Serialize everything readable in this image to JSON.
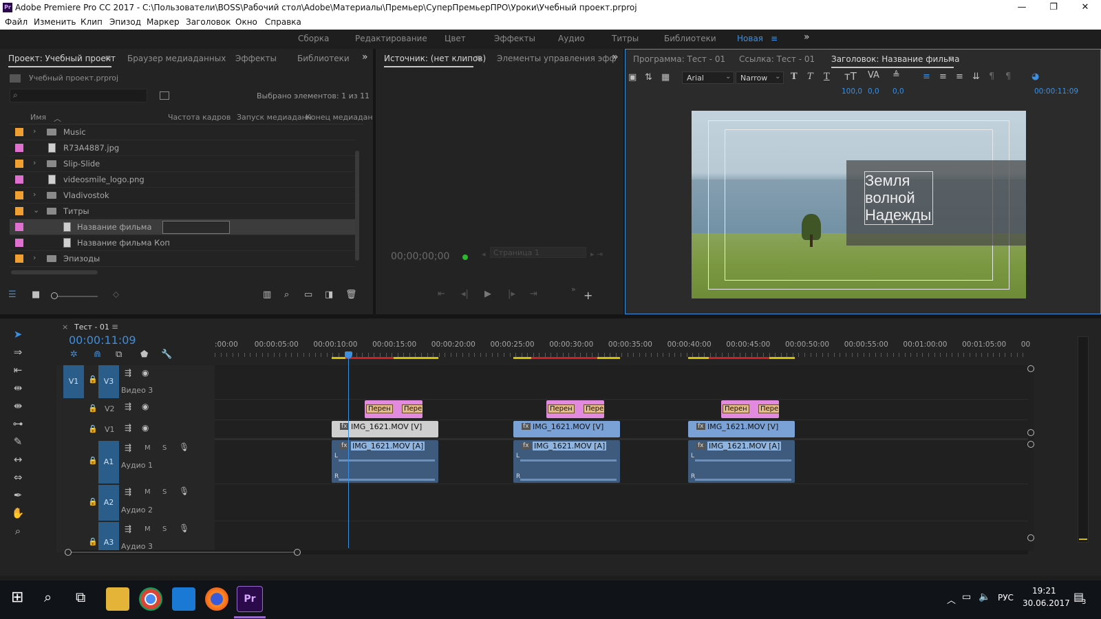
{
  "app": {
    "logo_text": "Pr",
    "title": "Adobe Premiere Pro CC 2017 - C:\\Пользователи\\BOSS\\Рабочий стол\\Adobe\\Материалы\\Премьер\\СуперПремьерПРО\\Уроки\\Учебный проект.prproj",
    "window_controls": [
      "—",
      "❐",
      "✕"
    ]
  },
  "menu": [
    "Файл",
    "Изменить",
    "Клип",
    "Эпизод",
    "Маркер",
    "Заголовок",
    "Окно",
    "Справка"
  ],
  "workspaces": {
    "items": [
      "Сборка",
      "Редактирование",
      "Цвет",
      "Эффекты",
      "Аудио",
      "Титры",
      "Библиотеки",
      "Новая"
    ],
    "active": "Новая",
    "more": "»"
  },
  "project_panel": {
    "tabs": [
      "Проект: Учебный проект",
      "Браузер медиаданных",
      "Эффекты",
      "Библиотеки"
    ],
    "file_name": "Учебный проект.prproj",
    "search_placeholder": "",
    "selected_info": "Выбрано элементов: 1 из 11",
    "columns": [
      "Имя",
      "Частота кадров",
      "Запуск медиаданн",
      "Конец медиадан"
    ],
    "items": [
      {
        "name": "Music",
        "type": "folder",
        "color": "#f0a030",
        "expandable": true
      },
      {
        "name": "R73A4887.jpg",
        "type": "image",
        "color": "#e070d0",
        "expandable": false
      },
      {
        "name": "Slip-Slide",
        "type": "folder",
        "color": "#f0a030",
        "expandable": true
      },
      {
        "name": "videosmile_logo.png",
        "type": "image",
        "color": "#e070d0",
        "expandable": false
      },
      {
        "name": "Vladivostok",
        "type": "folder",
        "color": "#f0a030",
        "expandable": true
      },
      {
        "name": "Титры",
        "type": "folder",
        "color": "#f0a030",
        "expandable": true,
        "open": true
      },
      {
        "name": "Название фильма",
        "type": "title",
        "color": "#e070d0",
        "selected": true
      },
      {
        "name": "Название фильма Коп",
        "type": "title",
        "color": "#e070d0"
      },
      {
        "name": "Эпизоды",
        "type": "folder",
        "color": "#f0a030",
        "expandable": true
      }
    ]
  },
  "source_panel": {
    "tabs": [
      "Источник: (нет клипов)",
      "Элементы управления эфф"
    ],
    "timecode": "00;00;00;00",
    "page_select": "Страница 1"
  },
  "program_panel": {
    "tabs": [
      "Программа: Тест - 01",
      "Ссылка: Тест - 01",
      "Заголовок: Название фильма"
    ],
    "font": "Arial",
    "font_style": "Narrow",
    "size_value": "100,0",
    "kerning_value": "0,0",
    "leading_value": "0,0",
    "timecode": "00:00:11:09",
    "title_lines": [
      "Земля",
      "волной",
      "Надежды"
    ]
  },
  "timeline": {
    "sequence_name": "Тест - 01",
    "timecode": "00:00:11:09",
    "ruler": [
      ":00:00",
      "00:00:05:00",
      "00:00:10:00",
      "00:00:15:00",
      "00:00:20:00",
      "00:00:25:00",
      "00:00:30:00",
      "00:00:35:00",
      "00:00:40:00",
      "00:00:45:00",
      "00:00:50:00",
      "00:00:55:00",
      "00:01:00:00",
      "00:01:05:00",
      "00"
    ],
    "tracks": {
      "v3": {
        "src": "V1",
        "name": "V3",
        "label": "Видео 3"
      },
      "v2": {
        "name": "V2"
      },
      "v1": {
        "name": "V1"
      },
      "a1": {
        "src": "A1",
        "name": "Аудио 1"
      },
      "a2": {
        "src": "A2",
        "name": "Аудио 2"
      },
      "a3": {
        "src": "A3",
        "name": "Аудио 3"
      }
    },
    "track_buttons": {
      "m": "M",
      "s": "S",
      "l": "L",
      "r": "R"
    },
    "transition_label": "Перен",
    "video_clip": "IMG_1621.MOV [V]",
    "audio_clip": "IMG_1621.MOV [A]"
  },
  "taskbar": {
    "lang": "РУС",
    "time": "19:21",
    "date": "30.06.2017",
    "notif": "3"
  }
}
